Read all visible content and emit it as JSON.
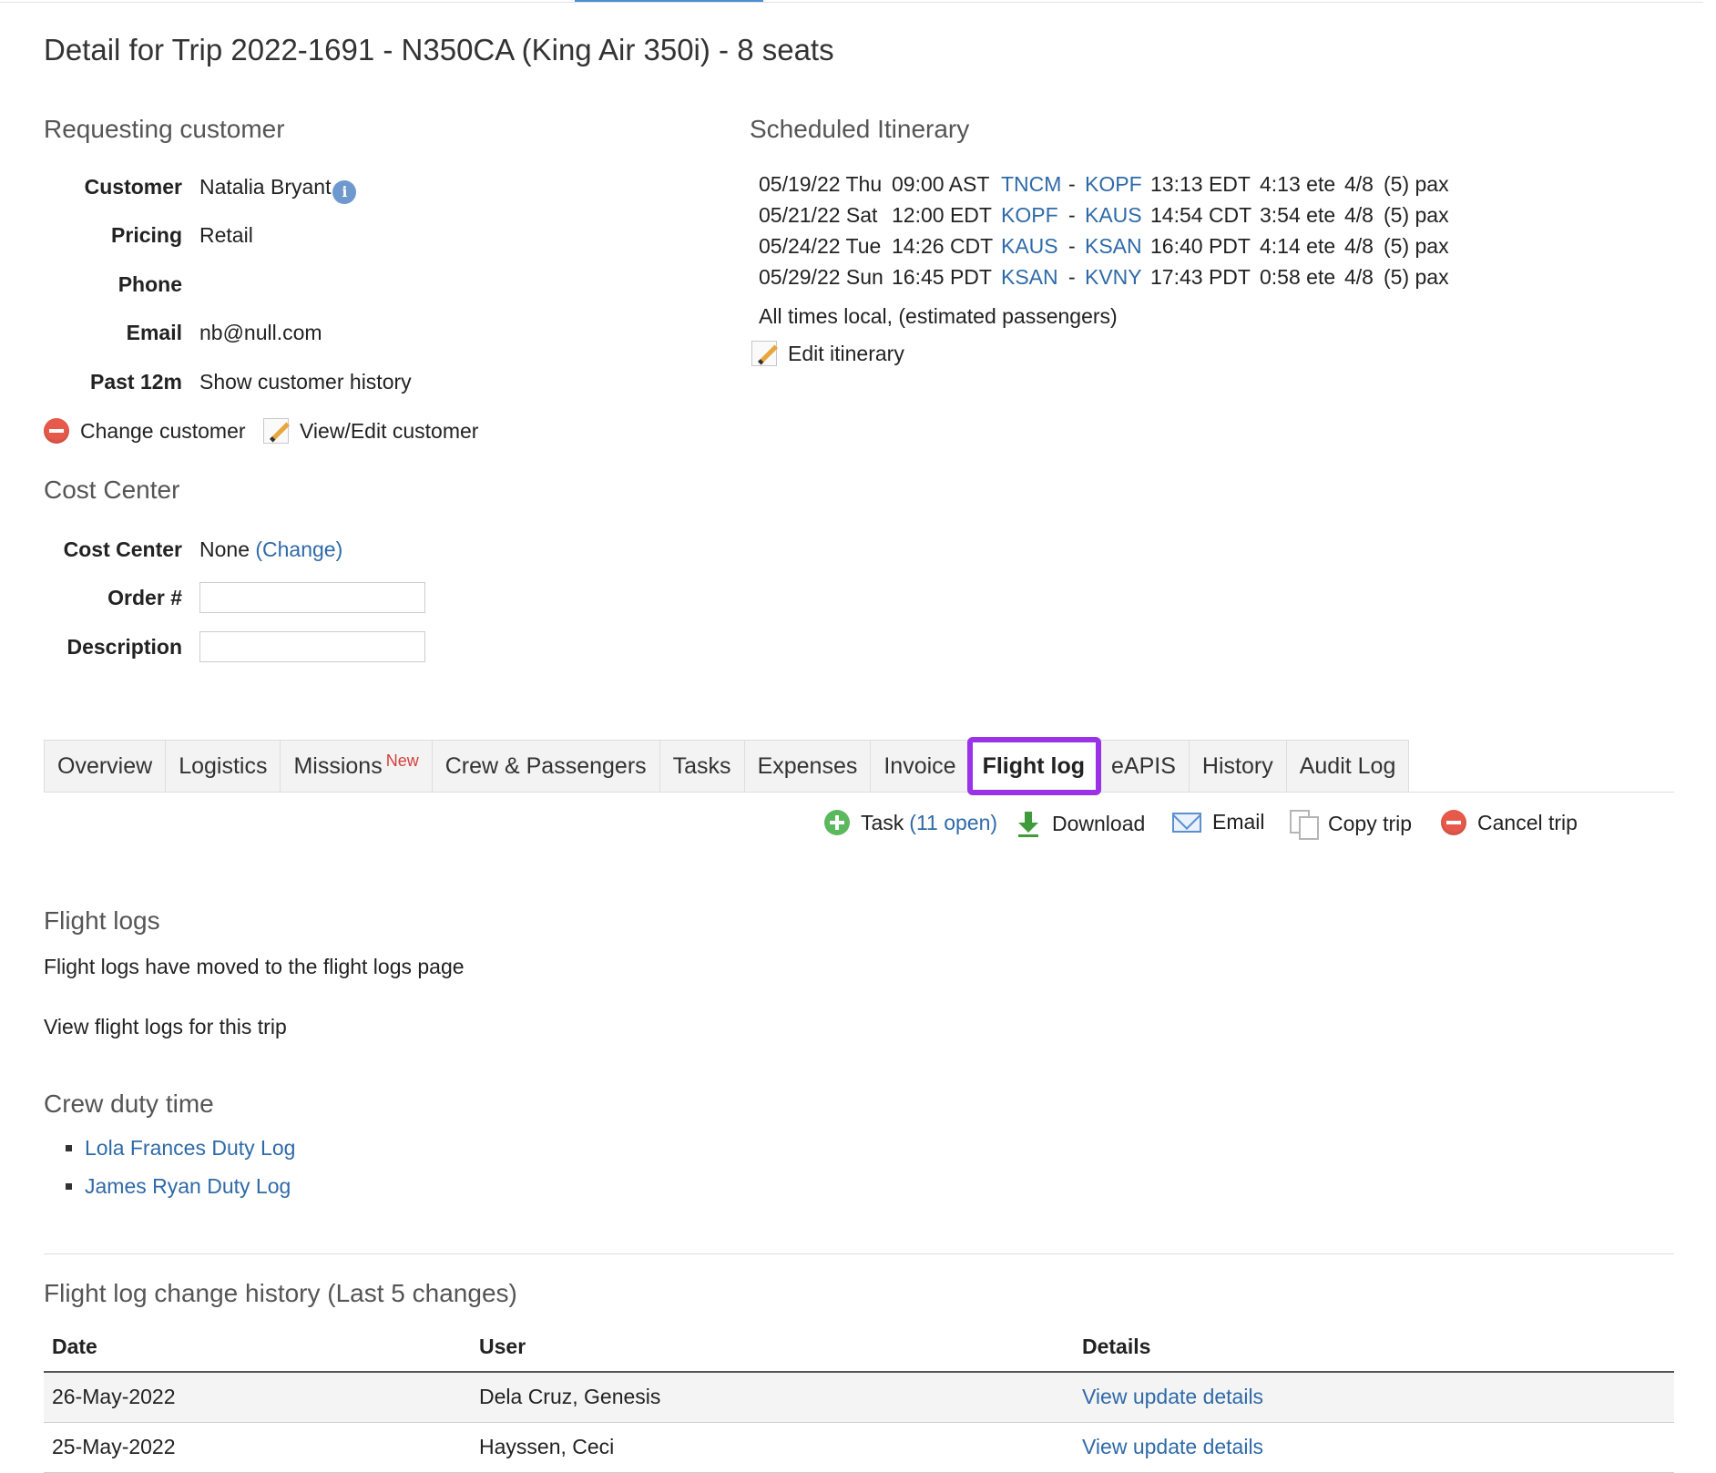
{
  "page": {
    "title": "Detail for Trip 2022-1691 - N350CA (King Air 350i) - 8 seats"
  },
  "customer": {
    "section_title": "Requesting customer",
    "customer_label": "Customer",
    "customer_value": "Natalia Bryant",
    "info_icon": "i",
    "pricing_label": "Pricing",
    "pricing_value": "Retail",
    "phone_label": "Phone",
    "phone_value": "",
    "email_label": "Email",
    "email_value": "nb@null.com",
    "past_label": "Past 12m",
    "past_link": "Show customer history",
    "change_customer": "Change customer",
    "view_edit_customer": "View/Edit customer"
  },
  "cost_center": {
    "section_title": "Cost Center",
    "cc_label": "Cost Center",
    "cc_value": "None",
    "change_link": "(Change)",
    "order_label": "Order #",
    "order_value": "",
    "description_label": "Description",
    "description_value": ""
  },
  "itinerary": {
    "section_title": "Scheduled Itinerary",
    "legs": [
      {
        "date": "05/19/22 Thu",
        "depart_time": "09:00 AST",
        "from": "TNCM",
        "sep": "-",
        "to": "KOPF",
        "arrive_time": "13:13 EDT",
        "ete": "4:13 ete",
        "seats": "4/8",
        "pax": "(5) pax"
      },
      {
        "date": "05/21/22 Sat",
        "depart_time": "12:00 EDT",
        "from": "KOPF",
        "sep": "-",
        "to": "KAUS",
        "arrive_time": "14:54 CDT",
        "ete": "3:54 ete",
        "seats": "4/8",
        "pax": "(5) pax"
      },
      {
        "date": "05/24/22 Tue",
        "depart_time": "14:26 CDT",
        "from": "KAUS",
        "sep": "-",
        "to": "KSAN",
        "arrive_time": "16:40 PDT",
        "ete": "4:14 ete",
        "seats": "4/8",
        "pax": "(5) pax"
      },
      {
        "date": "05/29/22 Sun",
        "depart_time": "16:45 PDT",
        "from": "KSAN",
        "sep": "-",
        "to": "KVNY",
        "arrive_time": "17:43 PDT",
        "ete": "0:58 ete",
        "seats": "4/8",
        "pax": "(5) pax"
      }
    ],
    "note": "All times local, (estimated passengers)",
    "edit_label": "Edit itinerary"
  },
  "tabs": [
    {
      "label": "Overview",
      "badge": ""
    },
    {
      "label": "Logistics",
      "badge": ""
    },
    {
      "label": "Missions",
      "badge": "New"
    },
    {
      "label": "Crew & Passengers",
      "badge": ""
    },
    {
      "label": "Tasks",
      "badge": ""
    },
    {
      "label": "Expenses",
      "badge": ""
    },
    {
      "label": "Invoice",
      "badge": ""
    },
    {
      "label": "Flight log",
      "badge": "",
      "active": true
    },
    {
      "label": "eAPIS",
      "badge": ""
    },
    {
      "label": "History",
      "badge": ""
    },
    {
      "label": "Audit Log",
      "badge": ""
    }
  ],
  "actions": {
    "task_label": "Task",
    "task_open": "(11 open)",
    "download_label": "Download",
    "email_label": "Email",
    "copy_label": "Copy trip",
    "cancel_label": "Cancel trip"
  },
  "flight_logs": {
    "section_title": "Flight logs",
    "moved_text": "Flight logs have moved to the flight logs page",
    "view_link": "View flight logs for this trip"
  },
  "crew_duty": {
    "section_title": "Crew duty time",
    "items": [
      "Lola Frances Duty Log",
      "James Ryan Duty Log"
    ]
  },
  "change_history": {
    "section_title": "Flight log change history (Last 5 changes)",
    "columns": [
      "Date",
      "User",
      "Details"
    ],
    "rows": [
      {
        "date": "26-May-2022",
        "user": "Dela Cruz, Genesis",
        "details": "View update details"
      },
      {
        "date": "25-May-2022",
        "user": "Hayssen, Ceci",
        "details": "View update details"
      }
    ]
  },
  "colors": {
    "link": "#2f6aa8",
    "active_tab_outline": "#9a32e8",
    "badge_new": "#d43f3a"
  }
}
